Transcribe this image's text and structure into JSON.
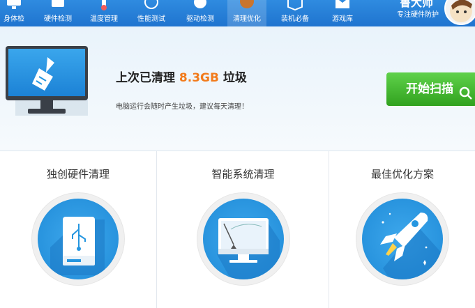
{
  "nav": {
    "items": [
      {
        "label": "身体检"
      },
      {
        "label": "硬件检测"
      },
      {
        "label": "温度管理"
      },
      {
        "label": "性能测试"
      },
      {
        "label": "驱动检测"
      },
      {
        "label": "清理优化",
        "active": true
      },
      {
        "label": "装机必备"
      },
      {
        "label": "游戏库"
      }
    ],
    "brand_tagline": "专注硬件防护",
    "brand_name": "鲁大师"
  },
  "hero": {
    "prefix": "上次已清理 ",
    "size": "8.3GB",
    "suffix": " 垃圾",
    "subtitle": "电脑运行会随时产生垃圾，建议每天清理！",
    "scan_button": "开始扫描"
  },
  "features": [
    {
      "title": "独创硬件清理",
      "icon": "usb-drive-icon"
    },
    {
      "title": "智能系统清理",
      "icon": "monitor-clean-icon"
    },
    {
      "title": "最佳优化方案",
      "icon": "rocket-icon"
    }
  ],
  "colors": {
    "nav_blue": "#2b84dc",
    "accent_orange": "#f27b1c",
    "button_green": "#3bb12a",
    "circle_blue": "#2596e0"
  }
}
